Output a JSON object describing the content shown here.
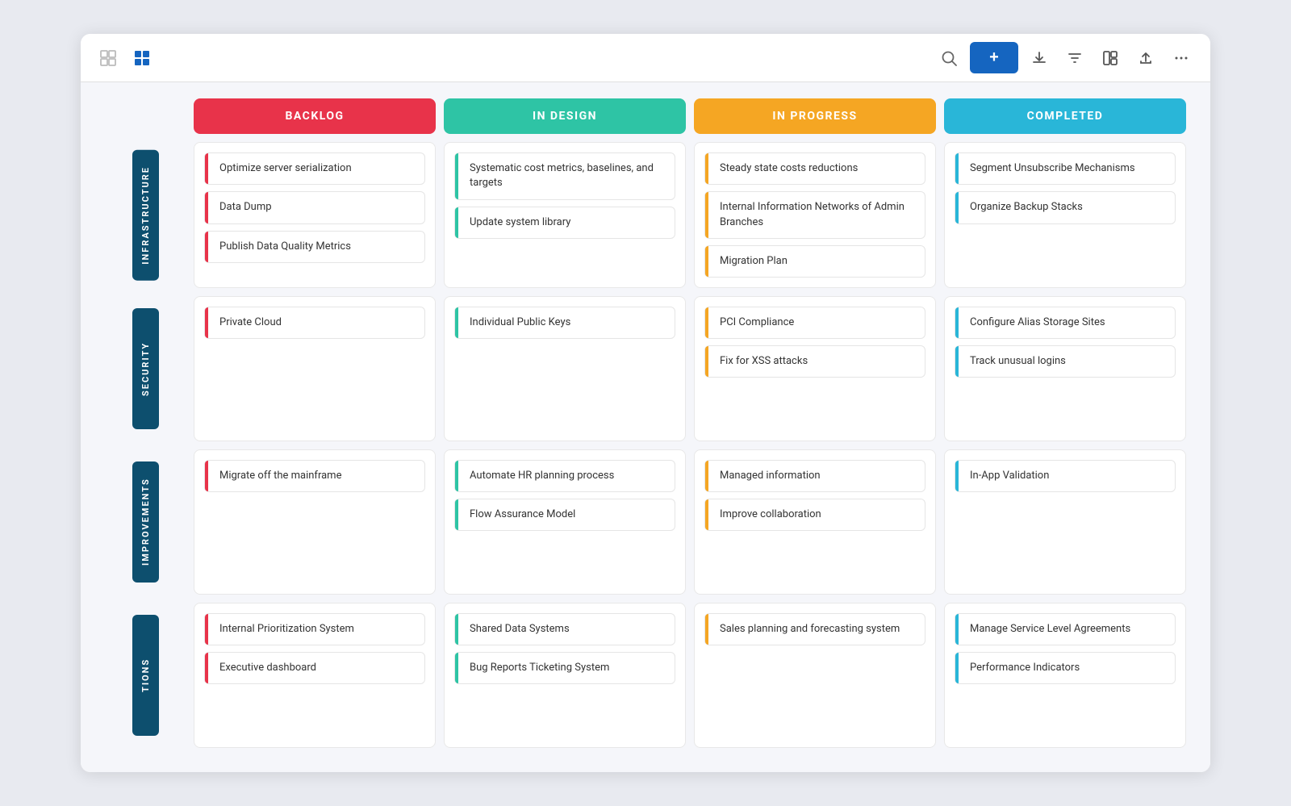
{
  "toolbar": {
    "add_label": "+",
    "icons": {
      "grid": "⊞",
      "tile": "⊟",
      "search": "🔍",
      "download": "⬇",
      "filter": "▽",
      "layout": "⊡",
      "upload": "⬆",
      "more": "···"
    }
  },
  "columns": [
    {
      "id": "backlog",
      "label": "BACKLOG",
      "color": "#e8334a"
    },
    {
      "id": "in-design",
      "label": "IN DESIGN",
      "color": "#2ec4a5"
    },
    {
      "id": "in-progress",
      "label": "IN PROGRESS",
      "color": "#f5a623"
    },
    {
      "id": "completed",
      "label": "COMPLETED",
      "color": "#29b6d8"
    }
  ],
  "rows": [
    {
      "id": "infrastructure",
      "label": "INFRASTRUCTURE",
      "cells": {
        "backlog": [
          "Optimize server serialization",
          "Data Dump",
          "Publish Data Quality Metrics"
        ],
        "in-design": [
          "Systematic cost metrics, baselines, and targets",
          "Update system library"
        ],
        "in-progress": [
          "Steady state costs reductions",
          "Internal Information Networks of Admin Branches",
          "Migration Plan"
        ],
        "completed": [
          "Segment Unsubscribe Mechanisms",
          "Organize Backup Stacks"
        ]
      }
    },
    {
      "id": "security",
      "label": "SECURITY",
      "cells": {
        "backlog": [
          "Private Cloud"
        ],
        "in-design": [
          "Individual Public Keys"
        ],
        "in-progress": [
          "PCI Compliance",
          "Fix for XSS attacks"
        ],
        "completed": [
          "Configure Alias Storage Sites",
          "Track unusual logins"
        ]
      }
    },
    {
      "id": "improvements",
      "label": "IMPROVEMENTS",
      "cells": {
        "backlog": [
          "Migrate off the mainframe"
        ],
        "in-design": [
          "Automate HR planning process",
          "Flow Assurance Model"
        ],
        "in-progress": [
          "Managed information",
          "Improve collaboration"
        ],
        "completed": [
          "In-App Validation"
        ]
      }
    },
    {
      "id": "tions",
      "label": "TIONS",
      "cells": {
        "backlog": [
          "Internal Prioritization System",
          "Executive dashboard"
        ],
        "in-design": [
          "Shared Data Systems",
          "Bug Reports Ticketing System"
        ],
        "in-progress": [
          "Sales planning and forecasting system"
        ],
        "completed": [
          "Manage Service Level Agreements",
          "Performance Indicators"
        ]
      }
    }
  ]
}
